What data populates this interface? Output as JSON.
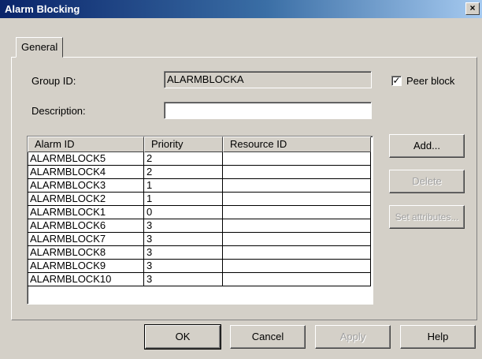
{
  "window": {
    "title": "Alarm Blocking",
    "close_glyph": "×"
  },
  "tabs": [
    {
      "label": "General"
    }
  ],
  "form": {
    "group_id_label": "Group ID:",
    "group_id_value": "ALARMBLOCKA",
    "description_label": "Description:",
    "description_value": "",
    "peer_block_label": "Peer block",
    "peer_block_checked": true,
    "peer_block_glyph": "✓"
  },
  "table": {
    "columns": [
      "Alarm ID",
      "Priority",
      "Resource ID"
    ],
    "rows": [
      [
        "ALARMBLOCK5",
        "2",
        ""
      ],
      [
        "ALARMBLOCK4",
        "2",
        ""
      ],
      [
        "ALARMBLOCK3",
        "1",
        ""
      ],
      [
        "ALARMBLOCK2",
        "1",
        ""
      ],
      [
        "ALARMBLOCK1",
        "0",
        ""
      ],
      [
        "ALARMBLOCK6",
        "3",
        ""
      ],
      [
        "ALARMBLOCK7",
        "3",
        ""
      ],
      [
        "ALARMBLOCK8",
        "3",
        ""
      ],
      [
        "ALARMBLOCK9",
        "3",
        ""
      ],
      [
        "ALARMBLOCK10",
        "3",
        ""
      ]
    ]
  },
  "side_buttons": {
    "add": "Add...",
    "delete": "Delete",
    "set_attributes": "Set attributes..."
  },
  "footer_buttons": {
    "ok": "OK",
    "cancel": "Cancel",
    "apply": "Apply",
    "help": "Help"
  }
}
